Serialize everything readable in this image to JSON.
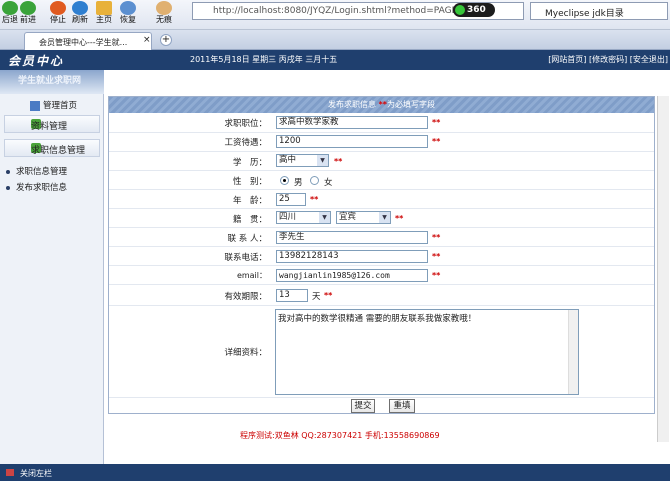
{
  "browser": {
    "nav": [
      "后退",
      "前进",
      "停止",
      "刷新",
      "主页",
      "恢复",
      "无痕"
    ],
    "address": "http://localhost:8080/JYQZ/Login.shtml?method=PAGEL",
    "badge_360": "360",
    "search_text": "Myeclipse jdk目录",
    "tab_title": "会员管理中心---学生就..."
  },
  "header": {
    "logo": "会员中心",
    "subtitle": "学生就业求职网",
    "date": "2011年5月18日 星期三 丙戌年 三月十五",
    "links": "[网站首页] [修改密码] [安全退出]"
  },
  "sidebar": {
    "home": "管理首页",
    "groups": [
      {
        "label": "资料管理"
      },
      {
        "label": "求职信息管理"
      }
    ],
    "items": [
      {
        "label": "求职信息管理"
      },
      {
        "label": "发布求职信息"
      }
    ]
  },
  "form": {
    "caption_main": "发布求职信息",
    "caption_star": "**",
    "caption_note": "为必填写字段",
    "star": "**",
    "job_label": "求职职位：",
    "job_value": "求高中数学家教",
    "salary_label": "工资待遇：",
    "salary_value": "1200",
    "edu_label": "学　历：",
    "edu_value": "高中",
    "gender_label": "性　别：",
    "gender_male": "男",
    "gender_female": "女",
    "age_label": "年　龄：",
    "age_value": "25",
    "origin_label": "籍　贯：",
    "province": "四川",
    "city": "宜宾",
    "contact_label": "联 系 人：",
    "contact_value": "李先生",
    "phone_label": "联系电话：",
    "phone_value": "13982128143",
    "email_label": "email：",
    "email_value": "wangjianlin1985@126.com",
    "valid_label": "有效期限：",
    "valid_value": "13",
    "valid_unit": "天",
    "detail_label": "详细资料：",
    "detail_value": "我对高中的数学很精通 需要的朋友联系我做家教哦！",
    "submit": "提交",
    "reset": "重填"
  },
  "footer": {
    "credit": "程序测试:双鱼林 QQ:287307421 手机:13558690869"
  },
  "status": {
    "close_left": "关闭左栏"
  },
  "colors": {
    "header": "#1f3f6e",
    "star": "#cc0000",
    "caption": "#7f9dc8"
  }
}
